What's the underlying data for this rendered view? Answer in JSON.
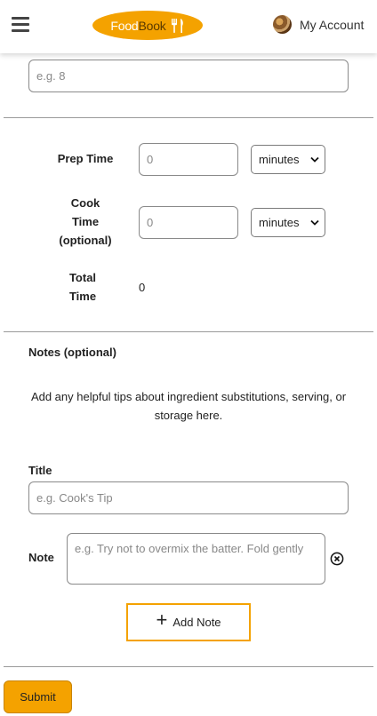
{
  "header": {
    "logo_part1": "Food",
    "logo_part2": "Book",
    "account_label": "My Account"
  },
  "servings": {
    "label": "",
    "placeholder": "e.g. 8"
  },
  "time": {
    "prep_label": "Prep Time",
    "prep_placeholder": "0",
    "prep_unit": "minutes",
    "cook_label_lines": [
      "Cook",
      "Time",
      "(optional)"
    ],
    "cook_placeholder": "0",
    "cook_unit": "minutes",
    "total_label_lines": [
      "Total",
      "Time"
    ],
    "total_value": "0"
  },
  "notes": {
    "heading": "Notes (optional)",
    "description": "Add any helpful tips about ingredient substitutions, serving, or storage here.",
    "title_label": "Title",
    "title_placeholder": "e.g. Cook's Tip",
    "note_label": "Note",
    "note_placeholder": "e.g. Try not to overmix the batter. Fold gently",
    "add_note_label": "Add Note"
  },
  "submit_label": "Submit",
  "colors": {
    "accent": "#f4a200",
    "border": "#8a8a8a"
  },
  "icons": [
    "menu-icon",
    "utensils-icon",
    "cookie-avatar",
    "close-circle-icon",
    "plus-icon",
    "chevron-down-icon"
  ]
}
